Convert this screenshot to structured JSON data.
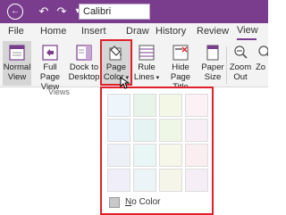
{
  "titlebar": {
    "font_name": "Calibri",
    "back_icon": "back-arrow-icon",
    "undo_icon": "undo-icon",
    "redo_icon": "redo-icon",
    "format_icon": "format-painter-icon",
    "accent": "#7a3d8e"
  },
  "tabs": [
    {
      "label": "File"
    },
    {
      "label": "Home"
    },
    {
      "label": "Insert"
    },
    {
      "label": "Draw"
    },
    {
      "label": "History"
    },
    {
      "label": "Review"
    },
    {
      "label": "View"
    }
  ],
  "ribbon": {
    "normal_view": {
      "line1": "Normal",
      "line2": "View",
      "icon": "normal-view-icon"
    },
    "full_page_view": {
      "line1": "Full Page",
      "line2": "View",
      "icon": "full-page-view-icon"
    },
    "dock_desktop": {
      "line1": "Dock to",
      "line2": "Desktop",
      "icon": "dock-desktop-icon"
    },
    "views_group": "Views",
    "page_color": {
      "line1": "Page",
      "line2": "Color",
      "icon": "page-color-bucket-icon"
    },
    "rule_lines": {
      "line1": "Rule",
      "line2": "Lines",
      "icon": "rule-lines-icon"
    },
    "hide_title": {
      "line1": "Hide",
      "line2": "Page Title",
      "icon": "hide-page-title-icon"
    },
    "paper_size": {
      "line1": "Paper",
      "line2": "Size",
      "icon": "paper-size-icon"
    },
    "zoom_out": {
      "line1": "Zoom",
      "line2": "Out",
      "icon": "zoom-out-icon"
    },
    "zoom_in": {
      "line1": "Zo",
      "line2": "",
      "icon": "zoom-in-icon"
    }
  },
  "page_color_panel": {
    "swatches": [
      [
        "#eef6fb",
        "#e8f4ea",
        "#f3f8e6",
        "#fcf1f4"
      ],
      [
        "#eaf2fb",
        "#e5f3f2",
        "#eef7e6",
        "#f8eef5"
      ],
      [
        "#eef0f8",
        "#e9f6f6",
        "#f6f7e8",
        "#fbeef0"
      ],
      [
        "#f0eef9",
        "#ecf4f8",
        "#f5f5ea",
        "#f6eef6"
      ]
    ],
    "no_color_label": "No Color",
    "highlight": "#e0202a"
  }
}
